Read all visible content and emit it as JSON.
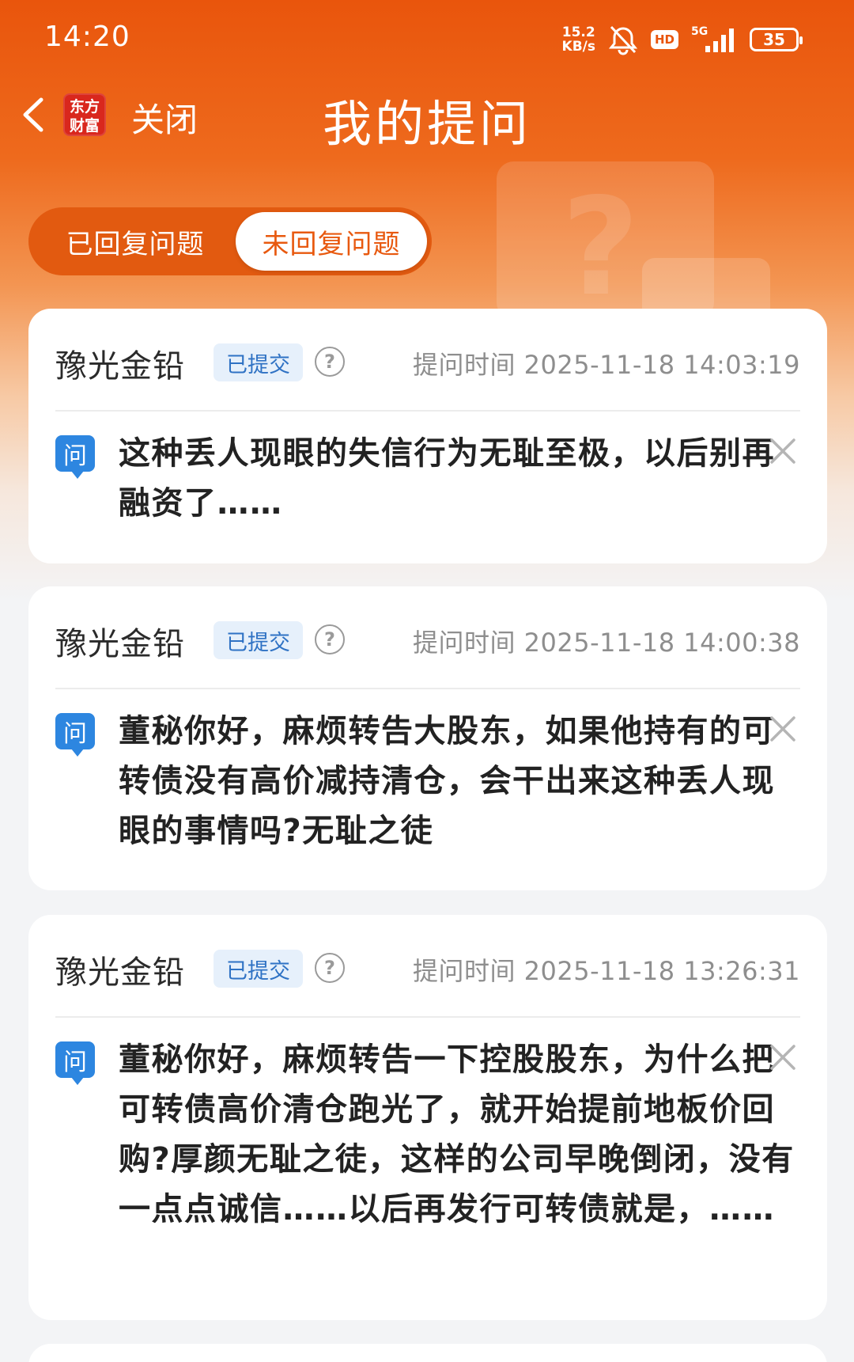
{
  "status_bar": {
    "time": "14:20",
    "net_speed_value": "15.2",
    "net_speed_unit": "KB/s",
    "hd_label": "HD",
    "network_label": "5G",
    "battery_level": "35"
  },
  "nav": {
    "logo_line1": "东方",
    "logo_line2": "财富",
    "close_label": "关闭",
    "title": "我的提问"
  },
  "tabs": {
    "answered": "已回复问题",
    "unanswered": "未回复问题",
    "active": "unanswered"
  },
  "questions": [
    {
      "stock": "豫光金铅",
      "status": "已提交",
      "time": "提问时间 2025-11-18 14:03:19",
      "q_label": "问",
      "text": "这种丢人现眼的失信行为无耻至极，以后别再融资了……"
    },
    {
      "stock": "豫光金铅",
      "status": "已提交",
      "time": "提问时间 2025-11-18 14:00:38",
      "q_label": "问",
      "text": "董秘你好，麻烦转告大股东，如果他持有的可转债没有高价减持清仓，会干出来这种丢人现眼的事情吗?无耻之徒"
    },
    {
      "stock": "豫光金铅",
      "status": "已提交",
      "time": "提问时间 2025-11-18 13:26:31",
      "q_label": "问",
      "text": "董秘你好，麻烦转告一下控股股东，为什么把可转债高价清仓跑光了，就开始提前地板价回购?厚颜无耻之徒，这样的公司早晚倒闭，没有一点点诚信……以后再发行可转债就是，……"
    }
  ],
  "colors": {
    "brand_orange": "#e9550c",
    "badge_blue": "#2f72c4",
    "question_icon_blue": "#2d86e0"
  }
}
